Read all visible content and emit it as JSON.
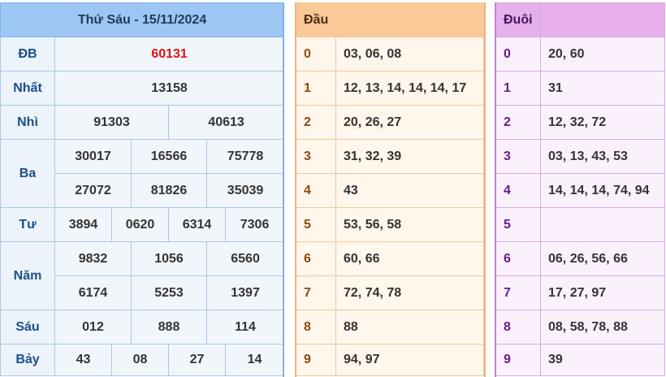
{
  "results": {
    "title": "Thứ Sáu - 15/11/2024",
    "prizes": {
      "db": {
        "label": "ĐB",
        "values": [
          "60131"
        ]
      },
      "nhat": {
        "label": "Nhất",
        "values": [
          "13158"
        ]
      },
      "nhi": {
        "label": "Nhì",
        "values": [
          "91303",
          "40613"
        ]
      },
      "ba": {
        "label": "Ba",
        "values": [
          "30017",
          "16566",
          "75778",
          "27072",
          "81826",
          "35039"
        ]
      },
      "tu": {
        "label": "Tư",
        "values": [
          "3894",
          "0620",
          "6314",
          "7306"
        ]
      },
      "nam": {
        "label": "Năm",
        "values": [
          "9832",
          "1056",
          "6560",
          "6174",
          "5253",
          "1397"
        ]
      },
      "sau": {
        "label": "Sáu",
        "values": [
          "012",
          "888",
          "114"
        ]
      },
      "bay": {
        "label": "Bảy",
        "values": [
          "43",
          "08",
          "27",
          "14"
        ]
      }
    }
  },
  "head": {
    "header": "Đầu",
    "rows": [
      {
        "digit": "0",
        "list": "03, 06, 08"
      },
      {
        "digit": "1",
        "list": "12, 13, 14, 14, 14, 17"
      },
      {
        "digit": "2",
        "list": "20, 26, 27"
      },
      {
        "digit": "3",
        "list": "31, 32, 39"
      },
      {
        "digit": "4",
        "list": "43"
      },
      {
        "digit": "5",
        "list": "53, 56, 58"
      },
      {
        "digit": "6",
        "list": "60, 66"
      },
      {
        "digit": "7",
        "list": "72, 74, 78"
      },
      {
        "digit": "8",
        "list": "88"
      },
      {
        "digit": "9",
        "list": "94, 97"
      }
    ]
  },
  "tail": {
    "header": "Đuôi",
    "rows": [
      {
        "digit": "0",
        "list": "20, 60"
      },
      {
        "digit": "1",
        "list": "31"
      },
      {
        "digit": "2",
        "list": "12, 32, 72"
      },
      {
        "digit": "3",
        "list": "03, 13, 43, 53"
      },
      {
        "digit": "4",
        "list": "14, 14, 14, 74, 94"
      },
      {
        "digit": "5",
        "list": ""
      },
      {
        "digit": "6",
        "list": "06, 26, 56, 66"
      },
      {
        "digit": "7",
        "list": "17, 27, 97"
      },
      {
        "digit": "8",
        "list": "08, 58, 78, 88"
      },
      {
        "digit": "9",
        "list": "39"
      }
    ]
  },
  "colors": {
    "results_header_bg": "#9ec6f4",
    "head_header_bg": "#fbc997",
    "tail_header_bg": "#e5b0ec",
    "special_prize": "#e0111b"
  }
}
